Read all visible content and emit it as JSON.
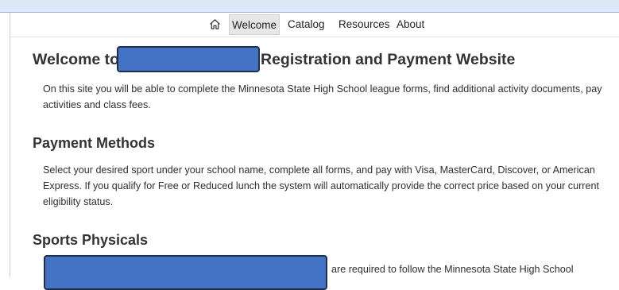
{
  "nav": {
    "home_icon": "home-icon",
    "items": [
      "Welcome",
      "Catalog",
      "Resources",
      "About"
    ],
    "active": "Welcome"
  },
  "welcome": {
    "title_prefix": "Welcome to",
    "title_suffix": "Registration and Payment Website",
    "paragraph": "On this site you will be able to complete the Minnesota State High School league forms, find additional activity documents, pay activities and class fees."
  },
  "payment": {
    "heading": "Payment Methods",
    "paragraph": "Select your desired sport under your school name, complete all forms, and pay with Visa, MasterCard, Discover, or American Express. If you qualify for Free or Reduced lunch the system will automatically provide the correct price based on your current eligibility status."
  },
  "sports": {
    "heading": "Sports Physicals",
    "paragraph_visible": "are required to follow the Minnesota State High School"
  },
  "colors": {
    "redaction_fill": "#4472c4",
    "redaction_border": "#1f2d4f",
    "active_tab_bg": "#e6e6e6"
  }
}
